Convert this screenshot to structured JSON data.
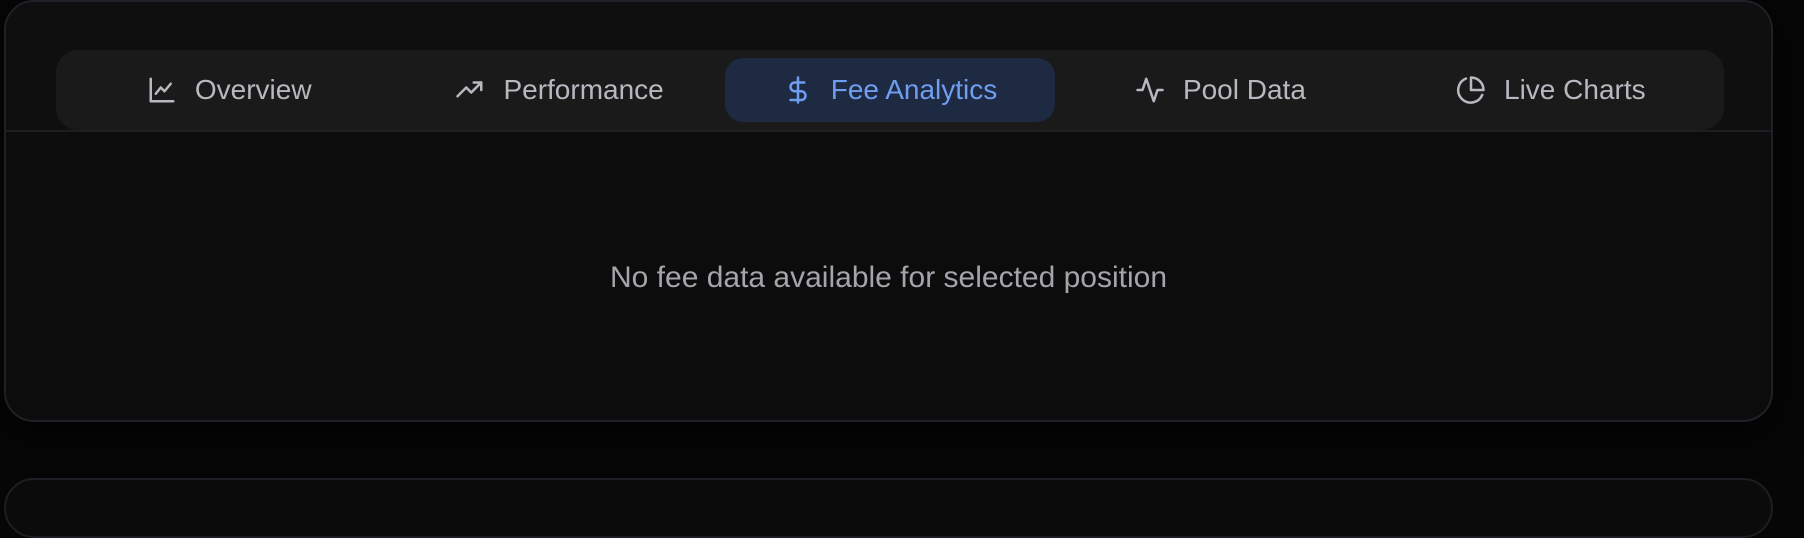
{
  "tabs": [
    {
      "label": "Overview",
      "icon": "line-chart-icon",
      "active": false
    },
    {
      "label": "Performance",
      "icon": "trending-up-icon",
      "active": false
    },
    {
      "label": "Fee Analytics",
      "icon": "dollar-icon",
      "active": true
    },
    {
      "label": "Pool Data",
      "icon": "activity-icon",
      "active": false
    },
    {
      "label": "Live Charts",
      "icon": "pie-chart-icon",
      "active": false
    }
  ],
  "content": {
    "empty_message": "No fee data available for selected position"
  },
  "colors": {
    "active_tab_bg": "#1e2942",
    "active_tab_text": "#6f9ef0",
    "tab_text": "#b7b9bf"
  }
}
